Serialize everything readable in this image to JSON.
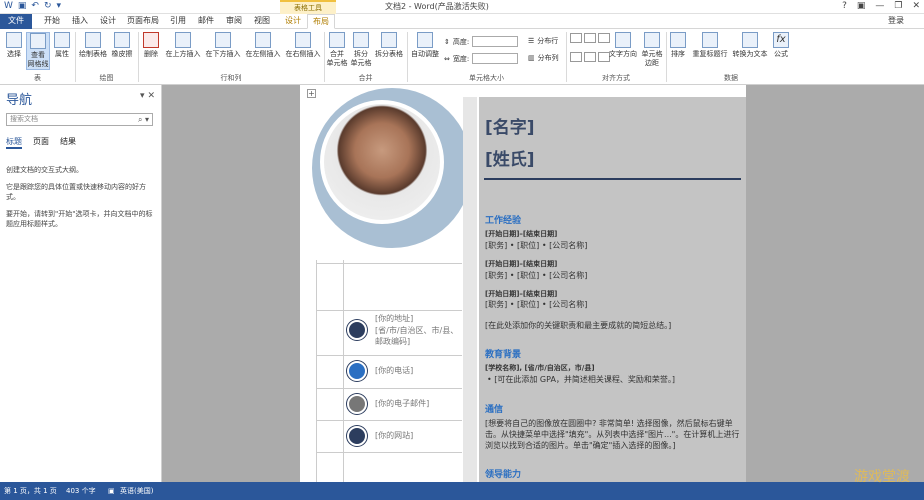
{
  "title_bar": {
    "doc_title": "文档2 - Word(产品激活失败)",
    "context_group": "表格工具",
    "window_controls": [
      "?",
      "▣",
      "—",
      "❐",
      "✕"
    ]
  },
  "tabs": [
    "文件",
    "开始",
    "插入",
    "设计",
    "页面布局",
    "引用",
    "邮件",
    "审阅",
    "视图",
    "设计",
    "布局"
  ],
  "login": "登录",
  "ribbon": {
    "buttons": {
      "select": "选择",
      "view_gridlines": "查看\n网格线",
      "properties": "属性",
      "draw_table": "绘制表格",
      "eraser": "橡皮擦",
      "delete": "删除",
      "insert_above": "在上方插入",
      "insert_below": "在下方插入",
      "insert_left": "在左侧插入",
      "insert_right": "在右侧插入",
      "merge_cells": "合并\n单元格",
      "split_cells": "拆分\n单元格",
      "split_table": "拆分表格",
      "autofit": "自动调整",
      "text_direction": "文字方向",
      "cell_margins": "单元格\n边距",
      "sort": "排序",
      "repeat_header": "重复标题行",
      "convert_to_text": "转换为文本",
      "formula": "公式"
    },
    "size": {
      "height_label": "高度:",
      "width_label": "宽度:",
      "distribute_rows": "分布行",
      "distribute_cols": "分布列"
    },
    "groups": [
      "表",
      "绘图",
      "行和列",
      "合并",
      "单元格大小",
      "对齐方式",
      "数据"
    ]
  },
  "nav": {
    "title": "导航",
    "search_placeholder": "搜索文档",
    "tabs": [
      "标题",
      "页面",
      "结果"
    ],
    "p1": "创建文档的交互式大纲。",
    "p2": "它是跟踪您的具体位置或快速移动内容的好方式。",
    "p3": "要开始，请转到\"开始\"选项卡，并向文档中的标题应用标题样式。"
  },
  "resume": {
    "first_name": "[名字]",
    "last_name": "[姓氏]",
    "work_title": "工作经验",
    "jobs": [
      {
        "dates": "[开始日期]–[结束日期]",
        "line": "[职务] • [职位] • [公司名称]"
      },
      {
        "dates": "[开始日期]–[结束日期]",
        "line": "[职务] • [职位] • [公司名称]"
      },
      {
        "dates": "[开始日期]–[结束日期]",
        "line": "[职务] • [职位] • [公司名称]"
      }
    ],
    "work_summary": "[在此处添加你的关键职责和最主要成就的简短总结。]",
    "edu_title": "教育背景",
    "school": "[学校名称], [省/市/自治区，市/县]",
    "edu_bullet": "[可在此添加 GPA，并简述相关课程、奖励和荣誉。]",
    "comm_title": "通信",
    "comm_text": "[想要将自己的图像放在圆圈中? 非常简单! 选择图像，然后鼠标右键单击。从快捷菜单中选择\"填充\"。从列表中选择\"图片...\"。在计算机上进行浏览以找到合适的图片。单击\"确定\"插入选择的图像。]",
    "skills_title": "领导能力",
    "address": "[你的地址]",
    "address2": "[省/市/自治区、市/县、邮政编码]",
    "phone": "[你的电话]",
    "email": "[你的电子邮件]",
    "website": "[你的网站]"
  },
  "status": {
    "page": "第 1 页，共 1 页",
    "words": "403 个字",
    "lang": "英语(美国)"
  },
  "watermark": "游戏堂渡"
}
